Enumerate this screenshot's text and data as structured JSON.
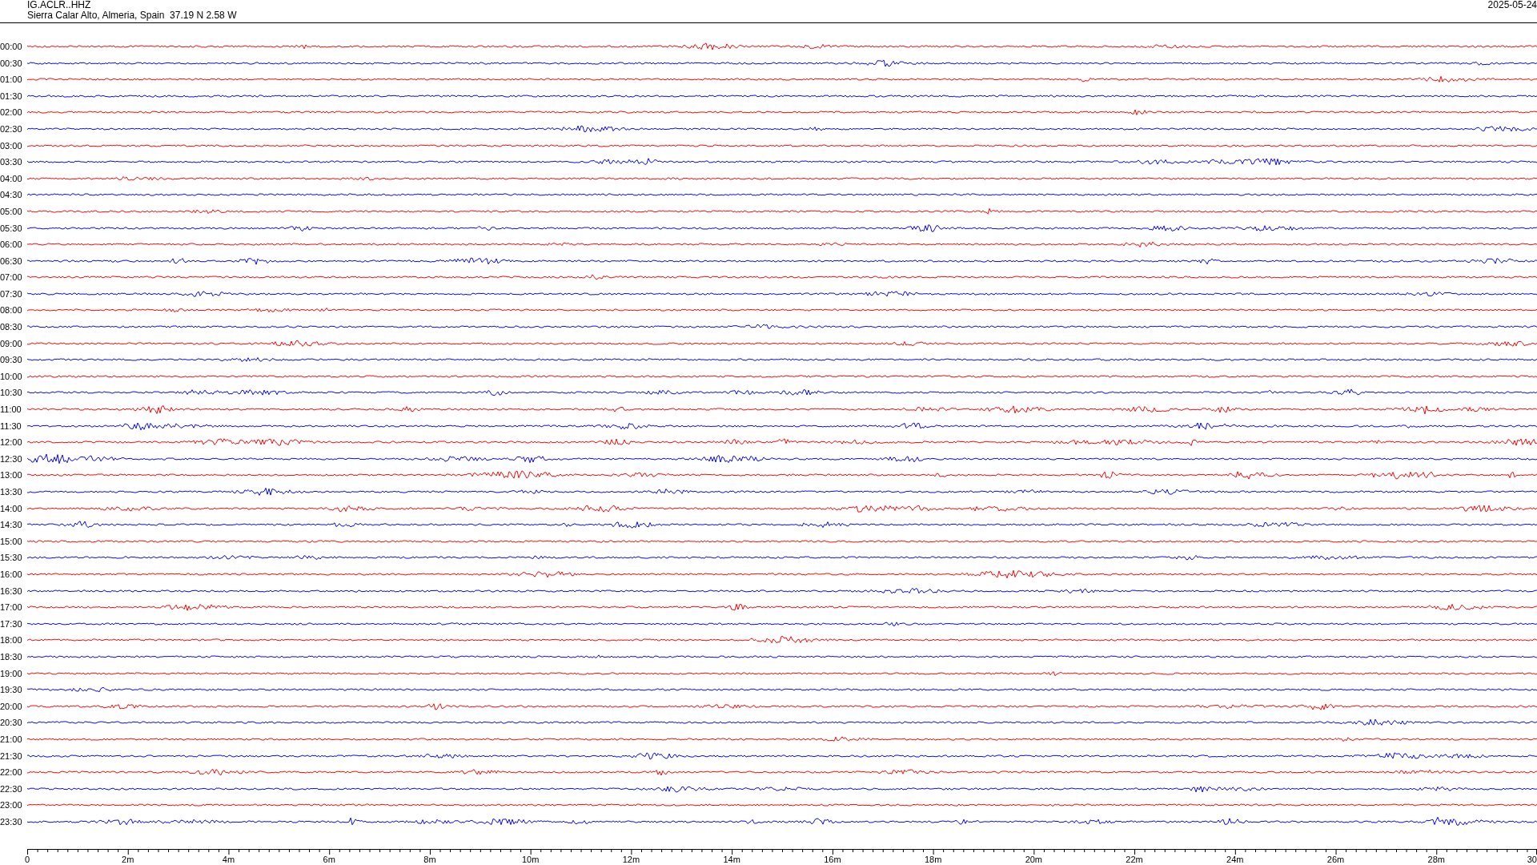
{
  "header": {
    "station": "IG.ACLR..HHZ",
    "location": "Sierra Calar Alto, Almeria, Spain  37.19 N 2.58 W",
    "date": "2025-05-24"
  },
  "traces": [
    {
      "time": "00:00",
      "color": "#ff0000"
    },
    {
      "time": "00:30",
      "color": "#0000ff"
    },
    {
      "time": "01:00",
      "color": "#ff0000"
    },
    {
      "time": "01:30",
      "color": "#0000ff"
    },
    {
      "time": "02:00",
      "color": "#ff0000"
    },
    {
      "time": "02:30",
      "color": "#0000ff"
    },
    {
      "time": "03:00",
      "color": "#ff0000"
    },
    {
      "time": "03:30",
      "color": "#0000ff"
    },
    {
      "time": "04:00",
      "color": "#ff0000"
    },
    {
      "time": "04:30",
      "color": "#0000ff"
    },
    {
      "time": "05:00",
      "color": "#ff0000"
    },
    {
      "time": "05:30",
      "color": "#0000ff"
    },
    {
      "time": "06:00",
      "color": "#ff0000"
    },
    {
      "time": "06:30",
      "color": "#0000ff"
    },
    {
      "time": "07:00",
      "color": "#ff0000"
    },
    {
      "time": "07:30",
      "color": "#0000ff"
    },
    {
      "time": "08:00",
      "color": "#ff0000"
    },
    {
      "time": "08:30",
      "color": "#0000ff"
    },
    {
      "time": "09:00",
      "color": "#ff0000"
    },
    {
      "time": "09:30",
      "color": "#0000ff"
    },
    {
      "time": "10:00",
      "color": "#ff0000"
    },
    {
      "time": "10:30",
      "color": "#0000ff"
    },
    {
      "time": "11:00",
      "color": "#ff0000"
    },
    {
      "time": "11:30",
      "color": "#0000ff"
    },
    {
      "time": "12:00",
      "color": "#ff0000"
    },
    {
      "time": "12:30",
      "color": "#0000ff"
    },
    {
      "time": "13:00",
      "color": "#ff0000"
    },
    {
      "time": "13:30",
      "color": "#0000ff"
    },
    {
      "time": "14:00",
      "color": "#ff0000"
    },
    {
      "time": "14:30",
      "color": "#0000ff"
    },
    {
      "time": "15:00",
      "color": "#ff0000"
    },
    {
      "time": "15:30",
      "color": "#0000ff"
    },
    {
      "time": "16:00",
      "color": "#ff0000"
    },
    {
      "time": "16:30",
      "color": "#0000ff"
    },
    {
      "time": "17:00",
      "color": "#ff0000"
    },
    {
      "time": "17:30",
      "color": "#0000ff"
    },
    {
      "time": "18:00",
      "color": "#ff0000"
    },
    {
      "time": "18:30",
      "color": "#0000ff"
    },
    {
      "time": "19:00",
      "color": "#ff0000"
    },
    {
      "time": "19:30",
      "color": "#0000ff"
    },
    {
      "time": "20:00",
      "color": "#ff0000"
    },
    {
      "time": "20:30",
      "color": "#0000ff"
    },
    {
      "time": "21:00",
      "color": "#ff0000"
    },
    {
      "time": "21:30",
      "color": "#0000ff"
    },
    {
      "time": "22:00",
      "color": "#ff0000"
    },
    {
      "time": "22:30",
      "color": "#0000ff"
    },
    {
      "time": "23:00",
      "color": "#ff0000"
    },
    {
      "time": "23:30",
      "color": "#0000ff"
    }
  ],
  "x_axis": {
    "ticks": [
      "0",
      "2m",
      "4m",
      "6m",
      "8m",
      "10m",
      "12m",
      "14m",
      "16m",
      "18m",
      "20m",
      "22m",
      "24m",
      "26m",
      "28m",
      "30"
    ]
  }
}
